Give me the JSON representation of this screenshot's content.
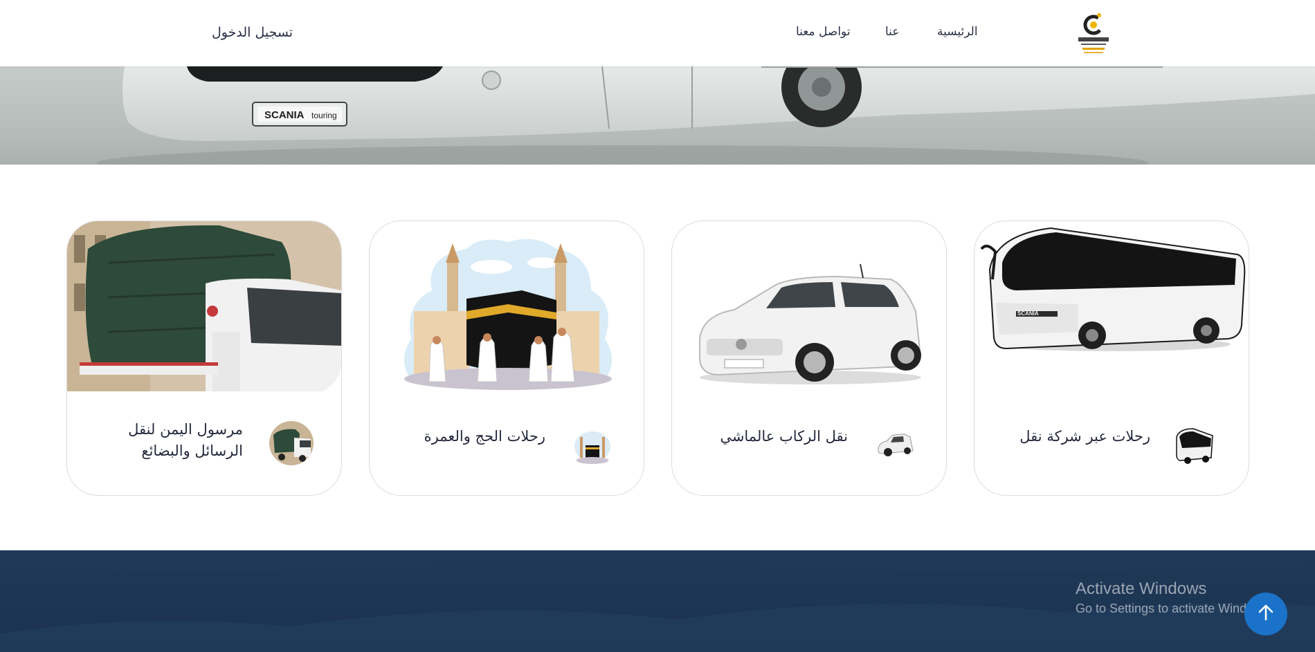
{
  "header": {
    "logo_alt": "Price Control",
    "nav": [
      {
        "label": "الرئيسية"
      },
      {
        "label": "عنا"
      },
      {
        "label": "تواصل معنا"
      }
    ],
    "login_label": "تسجيل الدخول"
  },
  "services": [
    {
      "title": "رحلات عبر شركة نقل",
      "image": "bus",
      "icon": "bus-icon"
    },
    {
      "title": "نقل الركاب عالماشي",
      "image": "car",
      "icon": "car-icon"
    },
    {
      "title": "رحلات الحج والعمرة",
      "image": "kaaba",
      "icon": "kaaba-icon"
    },
    {
      "title_line1": "مرسول اليمن لنقل",
      "title_line2": "الرسائل والبضائع",
      "image": "truck",
      "icon": "truck-icon"
    }
  ],
  "watermark": {
    "title": "Activate Windows",
    "subtitle": "Go to Settings to activate Windows."
  },
  "colors": {
    "footer": "#1f3957",
    "scroll_button": "#1a73c8",
    "text": "#262a3d"
  }
}
